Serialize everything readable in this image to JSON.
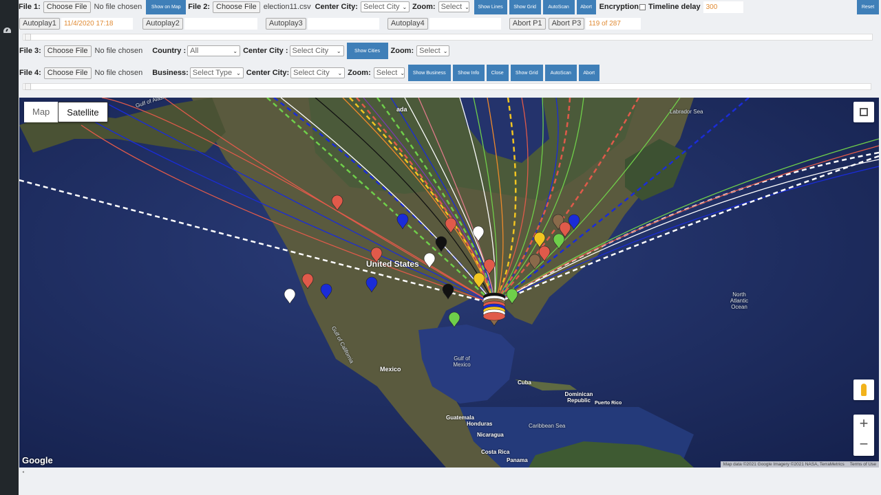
{
  "row1": {
    "file1_label": "File 1:",
    "file1_button": "Choose File",
    "file1_name": "No file chosen",
    "show_on_map": "Show on Map",
    "file2_label": "File 2:",
    "file2_button": "Choose File",
    "file2_name": "election11.csv",
    "center_city_label": "Center City:",
    "center_city_value": "Select City",
    "zoom_label": "Zoom:",
    "zoom_value": "Select",
    "buttons": [
      "Show Lines",
      "Show Grid",
      "AutoScan",
      "Abort"
    ],
    "encryption_label": "Encryption",
    "encryption_checked": false,
    "timeline_delay_label": "Timeline delay",
    "timeline_delay_value": "300",
    "reset": "Reset"
  },
  "row2": {
    "autoplay1": "Autoplay1",
    "autoplay1_value": "11/4/2020 17:18",
    "autoplay2": "Autoplay2",
    "autoplay2_value": "",
    "autoplay3": "Autoplay3",
    "autoplay3_value": "",
    "autoplay4": "Autoplay4",
    "autoplay4_value": "",
    "abort_p1": "Abort P1",
    "abort_p3": "Abort P3",
    "progress_text": "119 of 287"
  },
  "row3": {
    "file3_label": "File 3:",
    "file3_button": "Choose File",
    "file3_name": "No file chosen",
    "country_label": "Country :",
    "country_value": "All",
    "center_city_label": "Center City :",
    "center_city_value": "Select City",
    "show_cities": "Show Cities",
    "zoom_label": "Zoom:",
    "zoom_value": "Select"
  },
  "row4": {
    "file4_label": "File 4:",
    "file4_button": "Choose File",
    "file4_name": "No file chosen",
    "business_label": "Business:",
    "business_value": "Select Type",
    "center_city_label": "Center City:",
    "center_city_value": "Select City",
    "zoom_label": "Zoom:",
    "zoom_value": "Select",
    "buttons": [
      "Show Business",
      "Show Info",
      "Close",
      "Show Grid",
      "AutoScan",
      "Abort"
    ]
  },
  "map": {
    "type_map": "Map",
    "type_satellite": "Satellite",
    "active_type": "Satellite",
    "labels": {
      "gulf_of_alaska": "Gulf of Alaska",
      "labrador_sea": "Labrador Sea",
      "united_states": "United States",
      "north_atlantic": "North Atlantic Ocean",
      "gulf_of_california": "Gulf of California",
      "mexico": "Mexico",
      "gulf_of_mexico": "Gulf of Mexico",
      "cuba": "Cuba",
      "dominican_republic": "Dominican Republic",
      "puerto_rico": "Puerto Rico",
      "guatemala": "Guatemala",
      "honduras": "Honduras",
      "nicaragua": "Nicaragua",
      "caribbean_sea": "Caribbean Sea",
      "costa_rica": "Costa Rica",
      "panama": "Panama",
      "canada_partial": "ada"
    },
    "google_logo": "Google",
    "attribution": "Map data ©2021 Google Imagery ©2021 NASA, TerraMetrics",
    "terms": "Terms of Use",
    "zoom_in": "+",
    "zoom_out": "−",
    "colors": {
      "red": "#e05a4a",
      "blue": "#1a2cd8",
      "black": "#111111",
      "white": "#ffffff",
      "green": "#6fcf4a",
      "yellow": "#f2c521",
      "brown": "#8a6a4a",
      "orange": "#f08a2a",
      "pink": "#e07a8a",
      "purple": "#7a3ab0"
    }
  }
}
